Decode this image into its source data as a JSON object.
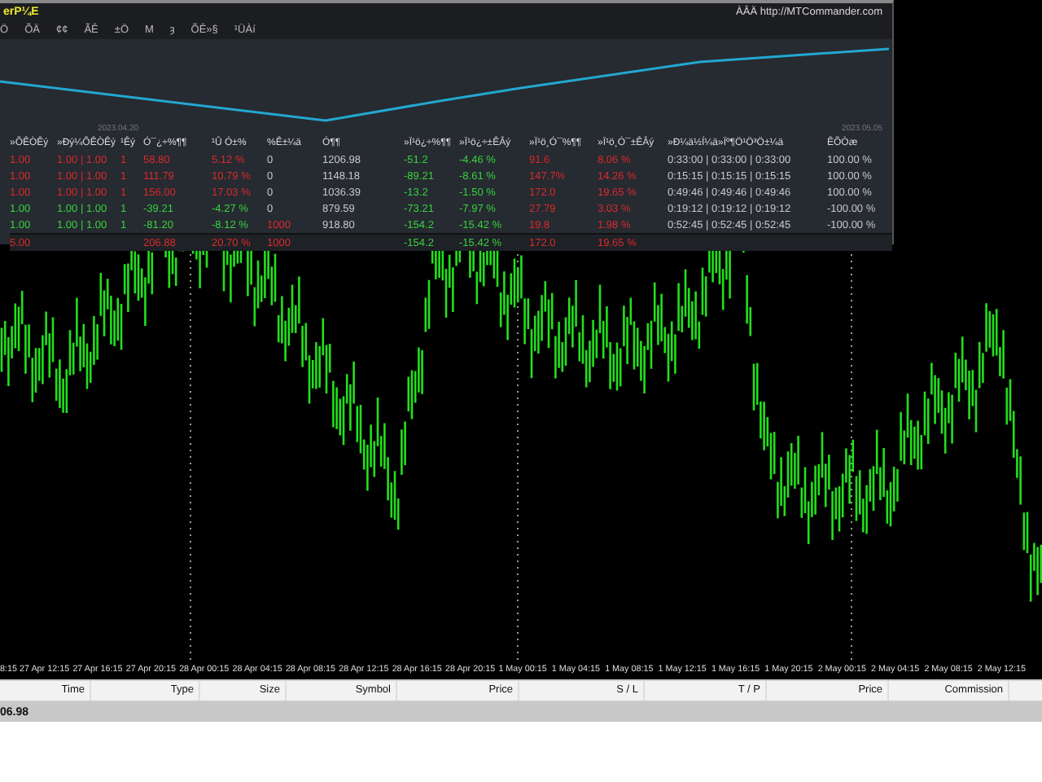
{
  "panel": {
    "title": "erP¼E",
    "toolbar": [
      "Ö",
      "ÕÄ",
      "¢¢",
      "ÃÊ",
      "±Ö",
      "M",
      "ȝ",
      "ÕÊ»§",
      "¹ÜÀí"
    ],
    "link": "ÀÂÄ http://MTCommander.com",
    "equity_chart": {
      "start_date": "2023.04.20",
      "end_date": "2023.05.05"
    },
    "table": {
      "columns": [
        "»ÕÊÒÊý",
        "»Ðý¼ÕÊÒÊý",
        "¹Êý",
        "Ó¯¿÷%¶¶",
        "¹Û Ó±%",
        "%Ê±¼ä",
        "Ó¶¶",
        "»Ï¹ö¿÷%¶¶",
        "»Ï¹ö¿÷±ÊÂý",
        "»Ï¹ö¸Ó¯%¶¶",
        "»Ï¹ö¸Ó¯±ÊÂý",
        "»Ð¼ä½Í¼ä»Ïº¶Ö¹Ö³Ö±¼ä",
        "ÊÕÒæ"
      ],
      "rows": [
        {
          "total": false,
          "cells": [
            {
              "text": "1.00",
              "color": "#d92b2b"
            },
            {
              "text": "1.00 | 1.00",
              "color": "#d92b2b"
            },
            {
              "text": "1",
              "color": "#d92b2b"
            },
            {
              "text": "58.80",
              "color": "#d92b2b"
            },
            {
              "text": "5.12 %",
              "color": "#d92b2b"
            },
            {
              "text": "0"
            },
            {
              "text": "1206.98"
            },
            {
              "text": "-51.2",
              "color": "#38d23c"
            },
            {
              "text": "-4.46 %",
              "color": "#38d23c"
            },
            {
              "text": "91.6",
              "color": "#d92b2b"
            },
            {
              "text": "8.06 %",
              "color": "#d92b2b"
            },
            {
              "text": "0:33:00 | 0:33:00 | 0:33:00"
            },
            {
              "text": "100.00 %"
            }
          ]
        },
        {
          "total": false,
          "cells": [
            {
              "text": "1.00",
              "color": "#d92b2b"
            },
            {
              "text": "1.00 | 1.00",
              "color": "#d92b2b"
            },
            {
              "text": "1",
              "color": "#d92b2b"
            },
            {
              "text": "111.79",
              "color": "#d92b2b"
            },
            {
              "text": "10.79 %",
              "color": "#d92b2b"
            },
            {
              "text": "0"
            },
            {
              "text": "1148.18"
            },
            {
              "text": "-89.21",
              "color": "#38d23c"
            },
            {
              "text": "-8.61 %",
              "color": "#38d23c"
            },
            {
              "text": "147.7%",
              "color": "#d92b2b"
            },
            {
              "text": "14.26 %",
              "color": "#d92b2b"
            },
            {
              "text": "0:15:15 | 0:15:15 | 0:15:15"
            },
            {
              "text": "100.00 %"
            }
          ]
        },
        {
          "total": false,
          "cells": [
            {
              "text": "1.00",
              "color": "#d92b2b"
            },
            {
              "text": "1.00 | 1.00",
              "color": "#d92b2b"
            },
            {
              "text": "1",
              "color": "#d92b2b"
            },
            {
              "text": "156.00",
              "color": "#d92b2b"
            },
            {
              "text": "17.03 %",
              "color": "#d92b2b"
            },
            {
              "text": "0"
            },
            {
              "text": "1036.39"
            },
            {
              "text": "-13.2",
              "color": "#38d23c"
            },
            {
              "text": "-1.50 %",
              "color": "#38d23c"
            },
            {
              "text": "172.0",
              "color": "#d92b2b"
            },
            {
              "text": "19.65 %",
              "color": "#d92b2b"
            },
            {
              "text": "0:49:46 | 0:49:46 | 0:49:46"
            },
            {
              "text": "100.00 %"
            }
          ]
        },
        {
          "total": false,
          "cells": [
            {
              "text": "1.00",
              "color": "#38d23c"
            },
            {
              "text": "1.00 | 1.00",
              "color": "#38d23c"
            },
            {
              "text": "1",
              "color": "#38d23c"
            },
            {
              "text": "-39.21",
              "color": "#38d23c"
            },
            {
              "text": "-4.27 %",
              "color": "#38d23c"
            },
            {
              "text": "0"
            },
            {
              "text": "879.59"
            },
            {
              "text": "-73.21",
              "color": "#38d23c"
            },
            {
              "text": "-7.97 %",
              "color": "#38d23c"
            },
            {
              "text": "27.79",
              "color": "#d92b2b"
            },
            {
              "text": "3.03 %",
              "color": "#d92b2b"
            },
            {
              "text": "0:19:12 | 0:19:12 | 0:19:12"
            },
            {
              "text": "-100.00 %"
            }
          ]
        },
        {
          "total": false,
          "cells": [
            {
              "text": "1.00",
              "color": "#38d23c"
            },
            {
              "text": "1.00 | 1.00",
              "color": "#38d23c"
            },
            {
              "text": "1",
              "color": "#38d23c"
            },
            {
              "text": "-81.20",
              "color": "#38d23c"
            },
            {
              "text": "-8.12 %",
              "color": "#38d23c"
            },
            {
              "text": "1000",
              "color": "#d92b2b"
            },
            {
              "text": "918.80"
            },
            {
              "text": "-154.2",
              "color": "#38d23c"
            },
            {
              "text": "-15.42 %",
              "color": "#38d23c"
            },
            {
              "text": "19.8",
              "color": "#d92b2b"
            },
            {
              "text": "1.98 %",
              "color": "#d92b2b"
            },
            {
              "text": "0:52:45 | 0:52:45 | 0:52:45"
            },
            {
              "text": "-100.00 %"
            }
          ]
        },
        {
          "total": true,
          "cells": [
            {
              "text": "5.00",
              "color": "#d92b2b"
            },
            null,
            null,
            {
              "text": "206.88",
              "color": "#d92b2b"
            },
            {
              "text": "20.70 %",
              "color": "#d92b2b"
            },
            {
              "text": "1000",
              "color": "#d92b2b"
            },
            null,
            {
              "text": "-154.2",
              "color": "#38d23c"
            },
            {
              "text": "-15.42 %",
              "color": "#38d23c"
            },
            {
              "text": "172.0",
              "color": "#d92b2b"
            },
            {
              "text": "19.65 %",
              "color": "#d92b2b"
            },
            null,
            null
          ]
        }
      ]
    }
  },
  "time_axis": [
    "8:15",
    "27 Apr 12:15",
    "27 Apr 16:15",
    "27 Apr 20:15",
    "28 Apr 00:15",
    "28 Apr 04:15",
    "28 Apr 08:15",
    "28 Apr 12:15",
    "28 Apr 16:15",
    "28 Apr 20:15",
    "1 May 00:15",
    "1 May 04:15",
    "1 May 08:15",
    "1 May 12:15",
    "1 May 16:15",
    "1 May 20:15",
    "2 May 00:15",
    "2 May 04:15",
    "2 May 08:15",
    "2 May 12:15"
  ],
  "orders_table": {
    "columns": [
      "Time",
      "Type",
      "Size",
      "Symbol",
      "Price",
      "S / L",
      "T / P",
      "Price",
      "Commission"
    ]
  },
  "balance": "06.98"
}
